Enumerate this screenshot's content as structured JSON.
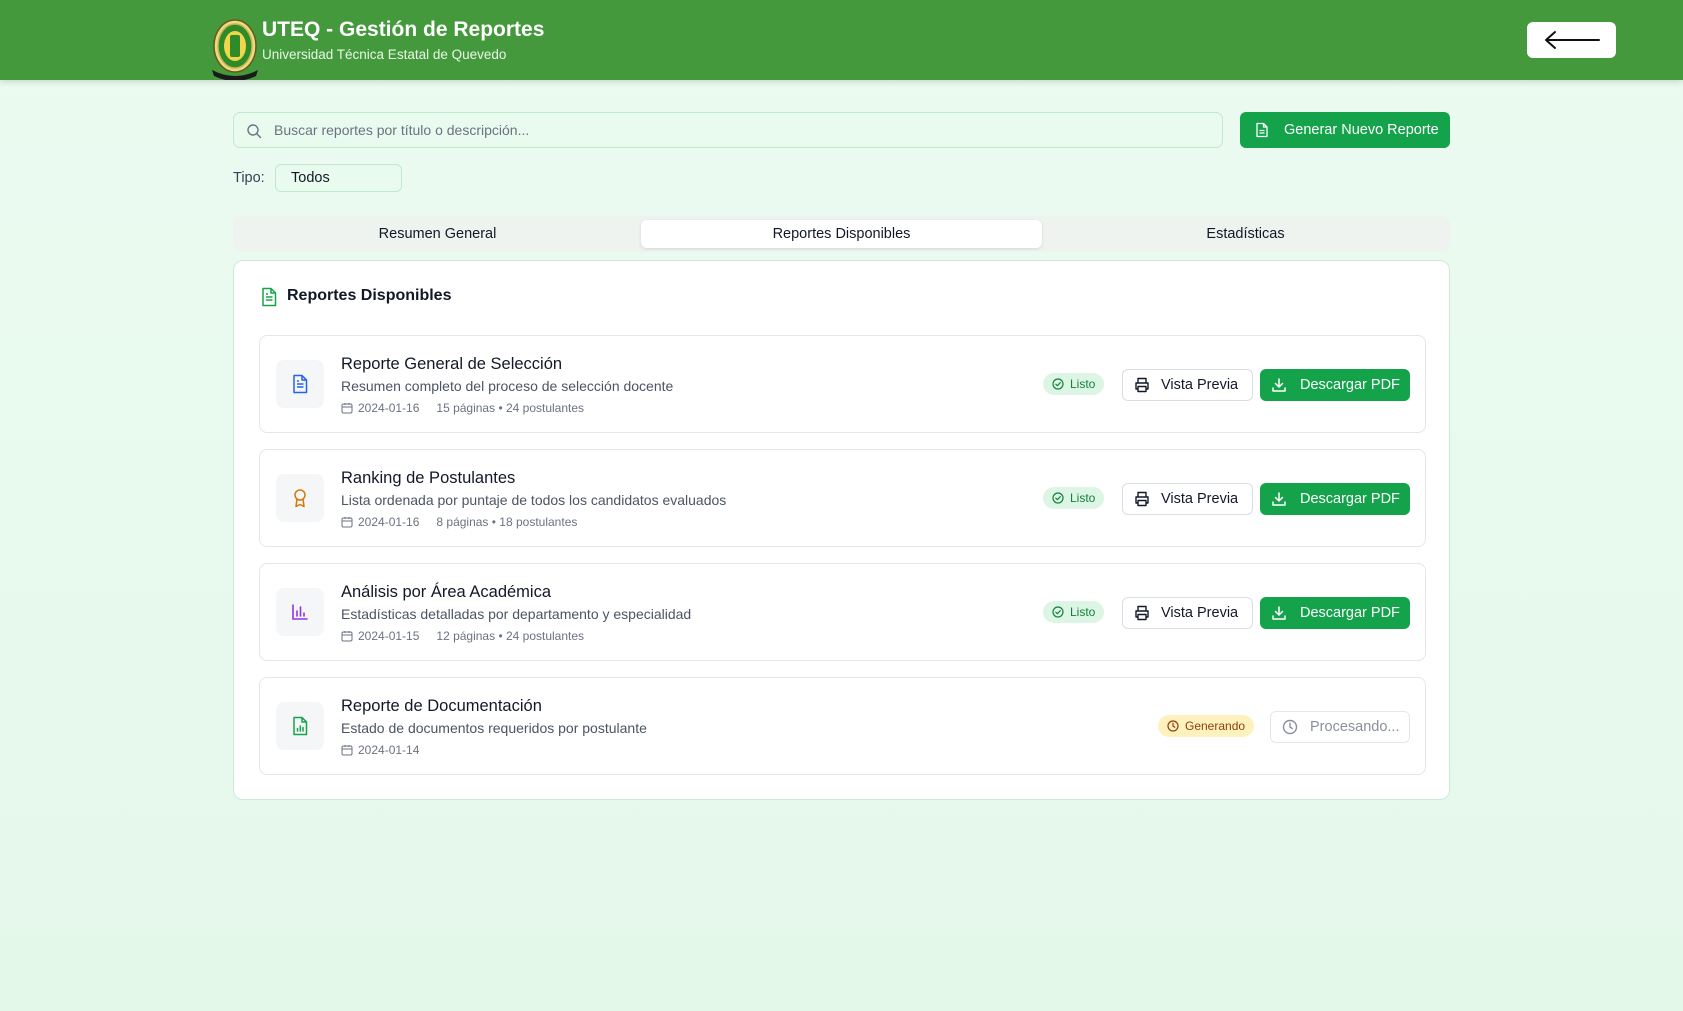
{
  "header": {
    "title": "UTEQ - Gestión de Reportes",
    "subtitle": "Universidad Técnica Estatal de Quevedo",
    "brand_color": "#43993c"
  },
  "search": {
    "placeholder": "Buscar reportes por título o descripción...",
    "value": ""
  },
  "toolbar": {
    "generate_label": "Generar Nuevo Reporte"
  },
  "filter": {
    "type_label": "Tipo:",
    "type_value": "Todos"
  },
  "tabs": [
    {
      "label": "Resumen General",
      "active": false
    },
    {
      "label": "Reportes Disponibles",
      "active": true
    },
    {
      "label": "Estadísticas",
      "active": false
    }
  ],
  "panel": {
    "title": "Reportes Disponibles"
  },
  "reports": [
    {
      "title": "Reporte General de Selección",
      "description": "Resumen completo del proceso de selección docente",
      "date": "2024-01-16",
      "extra": "15 páginas • 24 postulantes",
      "icon": "file-text-icon",
      "icon_color": "#2563eb",
      "status": "Listo",
      "preview_label": "Vista Previa",
      "download_label": "Descargar PDF"
    },
    {
      "title": "Ranking de Postulantes",
      "description": "Lista ordenada por puntaje de todos los candidatos evaluados",
      "date": "2024-01-16",
      "extra": "8 páginas • 18 postulantes",
      "icon": "award-icon",
      "icon_color": "#d97706",
      "status": "Listo",
      "preview_label": "Vista Previa",
      "download_label": "Descargar PDF"
    },
    {
      "title": "Análisis por Área Académica",
      "description": "Estadísticas detalladas por departamento y especialidad",
      "date": "2024-01-15",
      "extra": "12 páginas • 24 postulantes",
      "icon": "bar-chart-icon",
      "icon_color": "#9333ea",
      "status": "Listo",
      "preview_label": "Vista Previa",
      "download_label": "Descargar PDF"
    },
    {
      "title": "Reporte de Documentación",
      "description": "Estado de documentos requeridos por postulante",
      "date": "2024-01-14",
      "icon": "file-chart-icon",
      "icon_color": "#16a34a",
      "status": "Generando",
      "processing_label": "Procesando..."
    }
  ],
  "colors": {
    "accent_green": "#14a24b",
    "ready_badge": "#dcf5e4",
    "generating_badge": "#fdf1bd"
  }
}
